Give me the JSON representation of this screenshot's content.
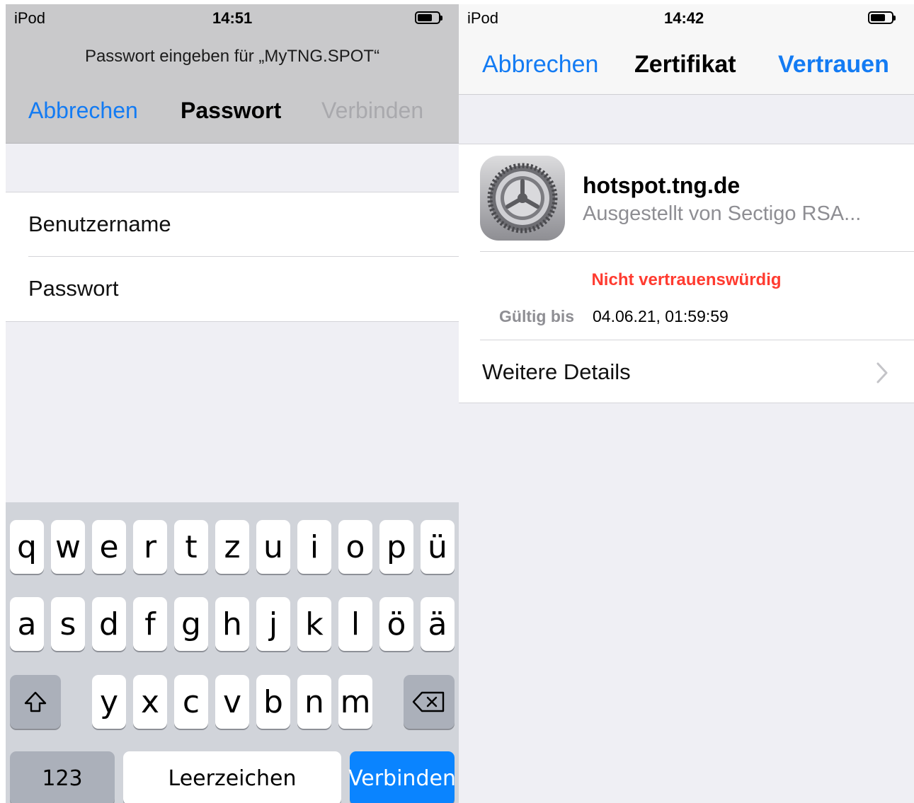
{
  "left": {
    "status": {
      "carrier": "iPod",
      "time": "14:51"
    },
    "prompt": "Passwort eingeben für „MyTNG.SPOT“",
    "nav": {
      "cancel": "Abbrechen",
      "title": "Passwort",
      "connect": "Verbinden"
    },
    "form": {
      "username_label": "Benutzername",
      "password_label": "Passwort"
    },
    "keyboard": {
      "row1": [
        "q",
        "w",
        "e",
        "r",
        "t",
        "z",
        "u",
        "i",
        "o",
        "p",
        "ü"
      ],
      "row2": [
        "a",
        "s",
        "d",
        "f",
        "g",
        "h",
        "j",
        "k",
        "l",
        "ö",
        "ä"
      ],
      "row3": [
        "y",
        "x",
        "c",
        "v",
        "b",
        "n",
        "m"
      ],
      "numbers": "123",
      "space": "Leerzeichen",
      "return": "Verbinden",
      "shift_icon": "shift-icon",
      "delete_icon": "backspace-icon"
    }
  },
  "right": {
    "status": {
      "carrier": "iPod",
      "time": "14:42"
    },
    "nav": {
      "cancel": "Abbrechen",
      "title": "Zertifikat",
      "trust": "Vertrauen"
    },
    "certificate": {
      "icon": "settings-gear-icon",
      "name": "hotspot.tng.de",
      "issuer": "Ausgestellt von Sectigo RSA...",
      "status": "Nicht vertrauenswürdig",
      "valid_label": "Gültig bis",
      "valid_value": "04.06.21, 01:59:59"
    },
    "more_details": "Weitere Details"
  },
  "colors": {
    "accent": "#137bf3",
    "danger": "#ff3b30",
    "key_return": "#0a84ff"
  }
}
